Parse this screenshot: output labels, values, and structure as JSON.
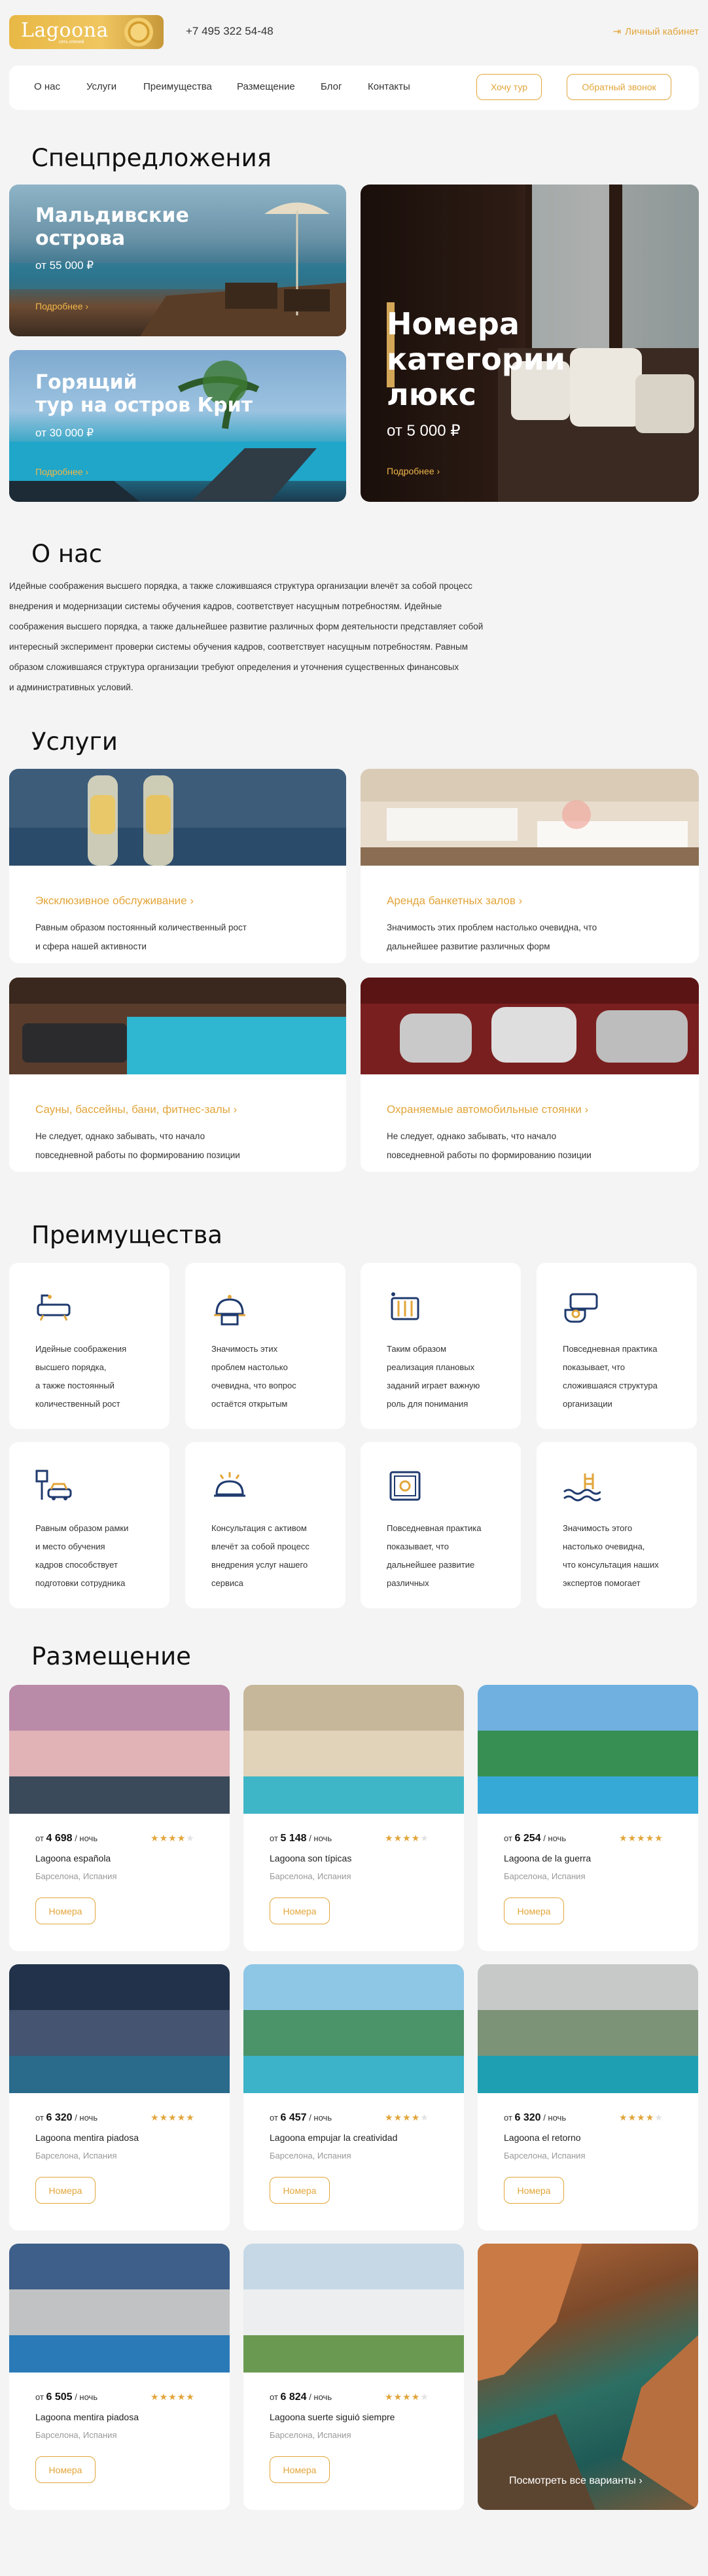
{
  "header": {
    "logo_text": "Lagoona",
    "logo_subtitle": "сеть отелей",
    "phone": "+7 495 322 54-48",
    "cabinet_label": "Личный кабинет",
    "cabinet_icon": "login-arrow-icon"
  },
  "nav": {
    "items": [
      "О нас",
      "Услуги",
      "Преимущества",
      "Размещение",
      "Блог",
      "Контакты"
    ],
    "tour_button": "Хочу тур",
    "callback_button": "Обратный звонок"
  },
  "colors": {
    "accent": "#e2a53a",
    "background": "#f4f4f4",
    "card": "#ffffff",
    "icon_navy": "#1f3a6e"
  },
  "specials": {
    "title": "Спецпредложения",
    "cards": [
      {
        "title_line1": "Мальдивские",
        "title_line2": "острова",
        "price": "от 55 000 ₽",
        "more": "Подробнее"
      },
      {
        "title_line1": "Горящий",
        "title_line2": "тур на остров Крит",
        "price": "от 30 000 ₽",
        "more": "Подробнее"
      },
      {
        "title_line1": "Номера",
        "title_line2": "категории",
        "title_line3": "люкс",
        "price": "от 5 000 ₽",
        "more": "Подробнее"
      }
    ]
  },
  "about": {
    "title": "О нас",
    "lines": [
      "Идейные соображения высшего порядка, а также сложившаяся структура организации влечёт за собой процесс",
      "внедрения и модернизации системы обучения кадров, соответствует насущным потребностям. Идейные",
      "соображения высшего порядка, а также дальнейшее развитие различных форм деятельности представляет собой",
      "интересный эксперимент проверки системы обучения кадров, соответствует насущным потребностям. Равным",
      "образом сложившаяся структура организации требуют определения и уточнения существенных финансовых",
      "и административных условий."
    ]
  },
  "services": {
    "title": "Услуги",
    "items": [
      {
        "title": "Эксклюзивное обслуживание",
        "line1": "Равным образом постоянный количественный рост",
        "line2": "и сфера нашей активности"
      },
      {
        "title": "Аренда банкетных залов",
        "line1": "Значимость этих проблем настолько очевидна, что",
        "line2": "дальнейшее развитие различных форм"
      },
      {
        "title": "Сауны, бассейны, бани, фитнес-залы",
        "line1": "Не следует, однако забывать, что начало",
        "line2": "повседневной работы по формированию позиции"
      },
      {
        "title": "Охраняемые автомобильные стоянки",
        "line1": "Не следует, однако забывать, что начало",
        "line2": "повседневной работы по формированию позиции"
      }
    ]
  },
  "advantages": {
    "title": "Преимущества",
    "items": [
      {
        "icon": "bathtub-icon",
        "lines": [
          "Идейные соображения",
          "высшего порядка,",
          "а также постоянный",
          "количественный рост"
        ]
      },
      {
        "icon": "concierge-bell-icon",
        "lines": [
          "Значимость этих",
          "проблем настолько",
          "очевидна, что вопрос",
          "остаётся открытым"
        ]
      },
      {
        "icon": "radiator-icon",
        "lines": [
          "Таким образом",
          "реализация плановых",
          "заданий играет важную",
          "роль для понимания"
        ]
      },
      {
        "icon": "hot-tea-icon",
        "lines": [
          "Повседневная практика",
          "показывает, что",
          "сложившаяся структура",
          "организации"
        ]
      },
      {
        "icon": "parking-car-icon",
        "lines": [
          "Равным образом рамки",
          "и место обучения",
          "кадров способствует",
          "подготовки сотрудника"
        ]
      },
      {
        "icon": "room-service-icon",
        "lines": [
          "Консультация с активом",
          "влечёт за собой процесс",
          "внедрения услуг нашего",
          "сервиса"
        ]
      },
      {
        "icon": "safe-icon",
        "lines": [
          "Повседневная практика",
          "показывает, что",
          "дальнейшее развитие",
          "различных"
        ]
      },
      {
        "icon": "pool-ladder-icon",
        "lines": [
          "Значимость этого",
          "настолько очевидна,",
          "что консультация наших",
          "экспертов помогает"
        ]
      }
    ]
  },
  "rooms": {
    "title": "Размещение",
    "per_night": "/ ночь",
    "price_prefix": "от",
    "button_label": "Номера",
    "see_all": "Посмотреть все варианты",
    "items": [
      {
        "price": "4 698",
        "name": "Lagoona española",
        "location": "Барселона, Испания",
        "stars": 4
      },
      {
        "price": "5 148",
        "name": "Lagoona son típicas",
        "location": "Барселона, Испания",
        "stars": 4
      },
      {
        "price": "6 254",
        "name": "Lagoona de la guerra",
        "location": "Барселона, Испания",
        "stars": 5
      },
      {
        "price": "6 320",
        "name": "Lagoona mentira piadosa",
        "location": "Барселона, Испания",
        "stars": 5
      },
      {
        "price": "6 457",
        "name": "Lagoona empujar la creatividad",
        "location": "Барселона, Испания",
        "stars": 4
      },
      {
        "price": "6 320",
        "name": "Lagoona el retorno",
        "location": "Барселона, Испания",
        "stars": 4
      },
      {
        "price": "6 505",
        "name": "Lagoona mentira piadosa",
        "location": "Барселона, Испания",
        "stars": 5
      },
      {
        "price": "6 824",
        "name": "Lagoona suerte siguió siempre",
        "location": "Барселона, Испания",
        "stars": 4
      }
    ]
  }
}
